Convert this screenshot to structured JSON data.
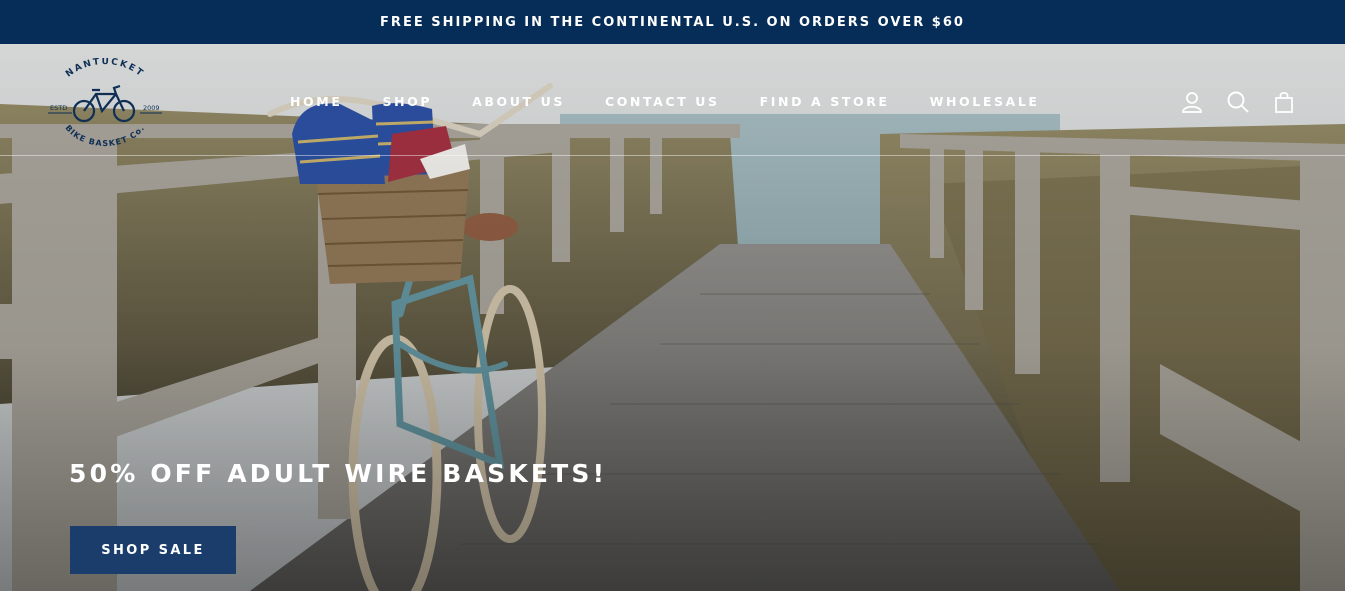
{
  "announcement": {
    "text": "FREE SHIPPING IN THE CONTINENTAL U.S. ON ORDERS OVER $60"
  },
  "logo": {
    "top_text": "NANTUCKET",
    "bottom_text": "BIKE BASKET Co.",
    "left_text": "ESTD",
    "right_text": "2009"
  },
  "nav": {
    "items": [
      {
        "label": "HOME"
      },
      {
        "label": "SHOP"
      },
      {
        "label": "ABOUT US"
      },
      {
        "label": "CONTACT US"
      },
      {
        "label": "FIND A STORE"
      },
      {
        "label": "WHOLESALE"
      }
    ]
  },
  "header_icons": [
    "account-icon",
    "search-icon",
    "cart-icon"
  ],
  "hero": {
    "headline": "50% OFF ADULT WIRE BASKETS!",
    "cta_label": "SHOP SALE"
  },
  "colors": {
    "announcement_bg": "#062d57",
    "button_bg": "#1a3d6b",
    "logo_ink": "#0f2f55"
  }
}
